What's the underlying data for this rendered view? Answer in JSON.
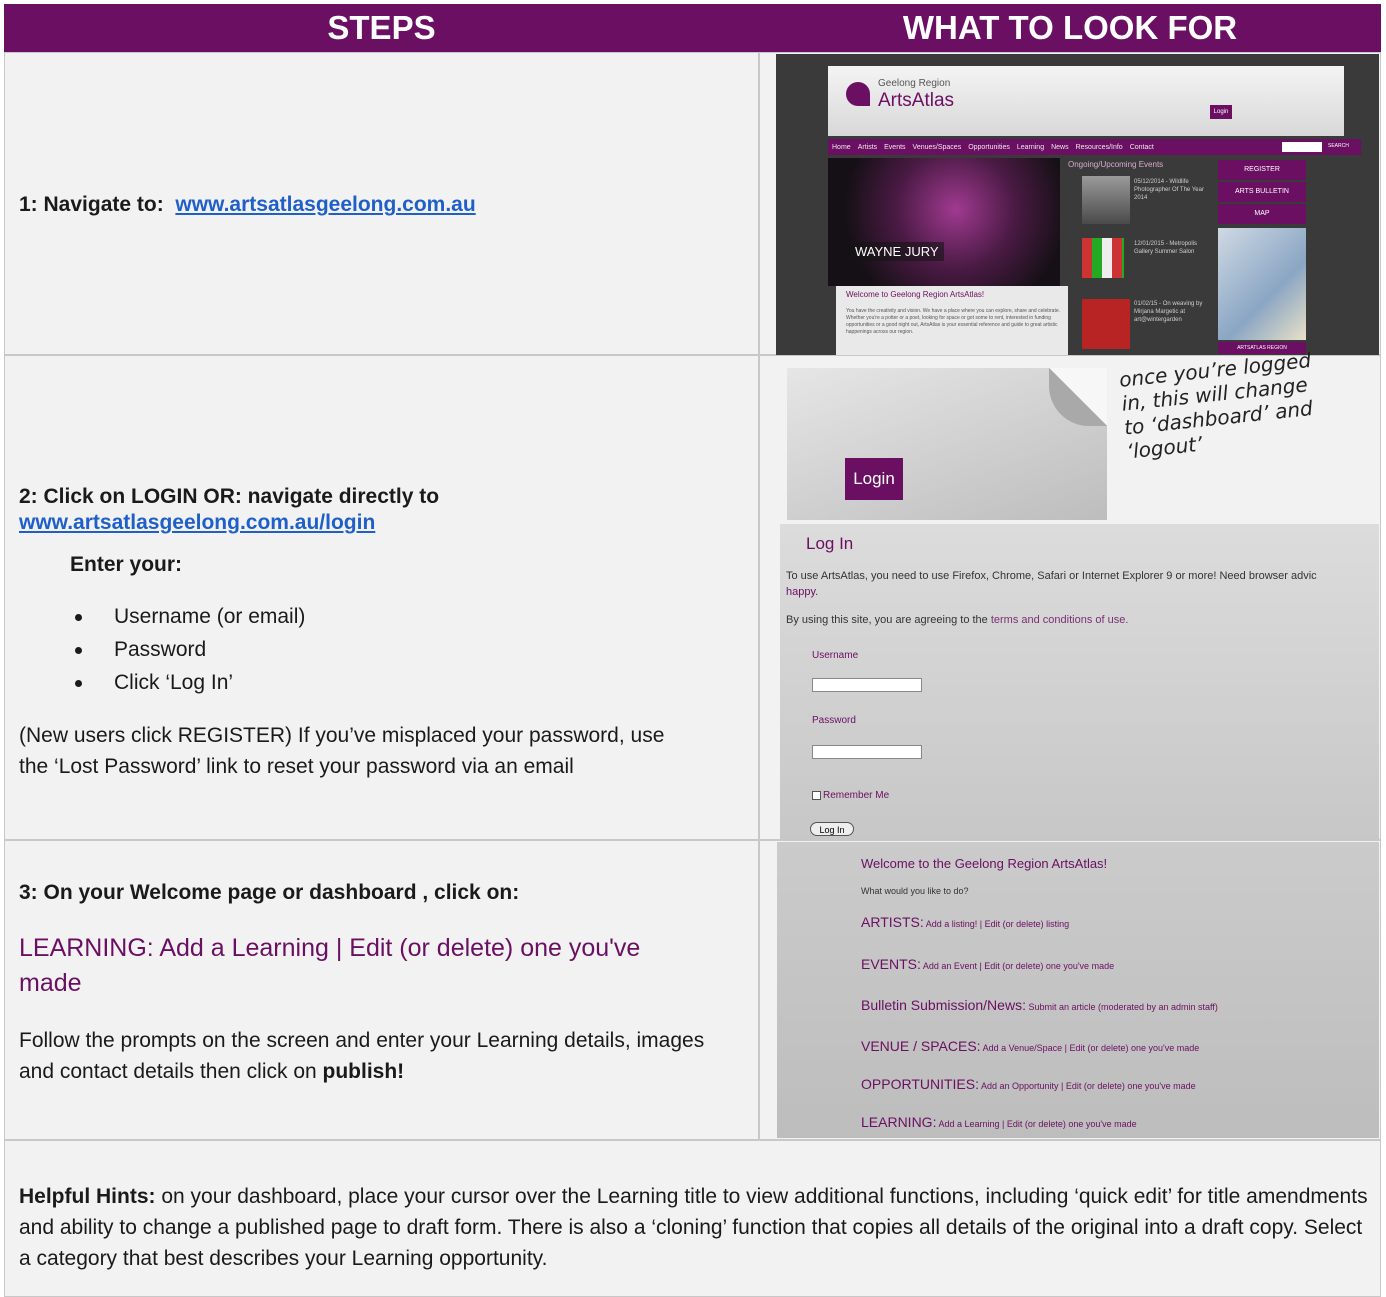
{
  "header": {
    "steps": "STEPS",
    "look": "WHAT TO LOOK FOR"
  },
  "step1": {
    "label": "1: Navigate to:",
    "url": "www.artsatlasgeelong.com.au"
  },
  "step2": {
    "label": "2: Click on LOGIN OR: navigate directly to",
    "url": "www.artsatlasgeelong.com.au/login",
    "enter": "Enter your:",
    "items": [
      "Username (or email)",
      "Password",
      "Click ‘Log In’"
    ],
    "note": "(New users click REGISTER) If you’ve misplaced your password, use the ‘Lost Password’ link to reset your password via an email"
  },
  "step3": {
    "label": "3: On your Welcome page or dashboard , click on:",
    "learning": "LEARNING: Add a Learning | Edit (or delete) one you've made",
    "follow": "Follow the prompts on the screen and enter your Learning details, images and contact details then click on ",
    "publish": "publish!"
  },
  "hints": {
    "bold": "Helpful Hints:",
    "text": " on your dashboard, place your cursor over the Learning title to view additional functions, including ‘quick edit’ for title amendments and ability to change a published page to draft form. There is also a ‘cloning’ function that copies all details of the original into a draft copy.  Select a category that best describes your Learning opportunity."
  },
  "shot1": {
    "brand_small": "Geelong Region",
    "brand": "ArtsAtlas",
    "login": "Login",
    "nav": [
      "Home",
      "Artists",
      "Events",
      "Venues/Spaces",
      "Opportunities",
      "Learning",
      "News",
      "Resources/Info",
      "Contact"
    ],
    "search": "SEARCH",
    "events_title": "Ongoing/Upcoming Events",
    "event1": "05/12/2014 - Wildlife Photographer Of The Year 2014",
    "event2": "12/01/2015 - Metropolis Gallery Summer Salon",
    "event3": "01/02/15 - On weaving by Mirjana Margetic at art@wintergarden",
    "buttons": [
      "REGISTER",
      "ARTS BULLETIN",
      "MAP"
    ],
    "footer_btn": "ARTSATLAS REGION",
    "artist": "WAYNE JURY",
    "welcome": "Welcome to Geelong Region ArtsAtlas!",
    "welcome_text": "You have the creativity and vision. We have a place where you can explore, share and celebrate. Whether you're a potter or a poet, looking for space or got some to rent, interested in funding opportunities or a good night out, ArtsAtlas is your essential reference and guide to great artistic happenings across our region."
  },
  "shot2": {
    "login": "Login",
    "handwritten": [
      "once you’re logged",
      "in, this will change",
      "to ‘dashboard’ and",
      "‘logout’"
    ]
  },
  "shot3": {
    "title": "Log In",
    "intro": "To use ArtsAtlas, you need to use Firefox, Chrome, Safari or Internet Explorer 9 or more! Need browser advic",
    "happy": "happy.",
    "agree_pre": "By using this site, you are agreeing to the ",
    "agree_link": "terms and conditions of use.",
    "username": "Username",
    "password": "Password",
    "remember": "Remember Me",
    "button": "Log In"
  },
  "shot4": {
    "title": "Welcome to the Geelong Region ArtsAtlas!",
    "question": "What would you like to do?",
    "rows": [
      {
        "head": "ARTISTS:",
        "rest": " Add a listing! | Edit (or delete) listing"
      },
      {
        "head": "EVENTS:",
        "rest": " Add an Event | Edit (or delete) one you've made"
      },
      {
        "head": "Bulletin Submission/News:",
        "rest": " Submit an article (moderated by an admin staff)"
      },
      {
        "head": "VENUE / SPACES:",
        "rest": " Add a Venue/Space | Edit (or delete) one you've made"
      },
      {
        "head": "OPPORTUNITIES:",
        "rest": " Add an Opportunity | Edit (or delete) one you've made"
      },
      {
        "head": "LEARNING:",
        "rest": " Add a Learning | Edit (or delete) one you've made"
      }
    ]
  },
  "colors": {
    "header_bg": "#6b0f62",
    "accent_purple": "#6b0f62",
    "link_blue": "#1f5fc9",
    "cell_bg": "#f2f2f2"
  }
}
